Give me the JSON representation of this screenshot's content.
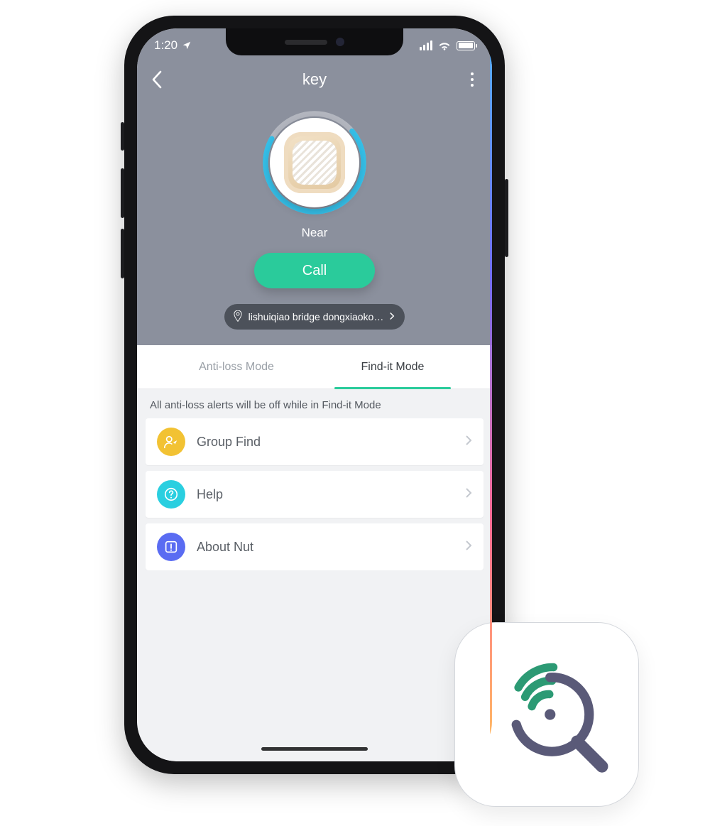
{
  "status": {
    "time": "1:20"
  },
  "nav": {
    "title": "key"
  },
  "device": {
    "proximity": "Near",
    "call_label": "Call",
    "location": "lishuiqiao bridge dongxiaoko…"
  },
  "tabs": {
    "anti_loss": "Anti-loss Mode",
    "find_it": "Find-it Mode",
    "active": "find_it"
  },
  "note": "All anti-loss alerts will be off while in Find-it Mode",
  "rows": {
    "group_find": "Group Find",
    "help": "Help",
    "about": "About Nut"
  },
  "colors": {
    "accent": "#2acb9b",
    "hero_bg": "#8b909d"
  }
}
